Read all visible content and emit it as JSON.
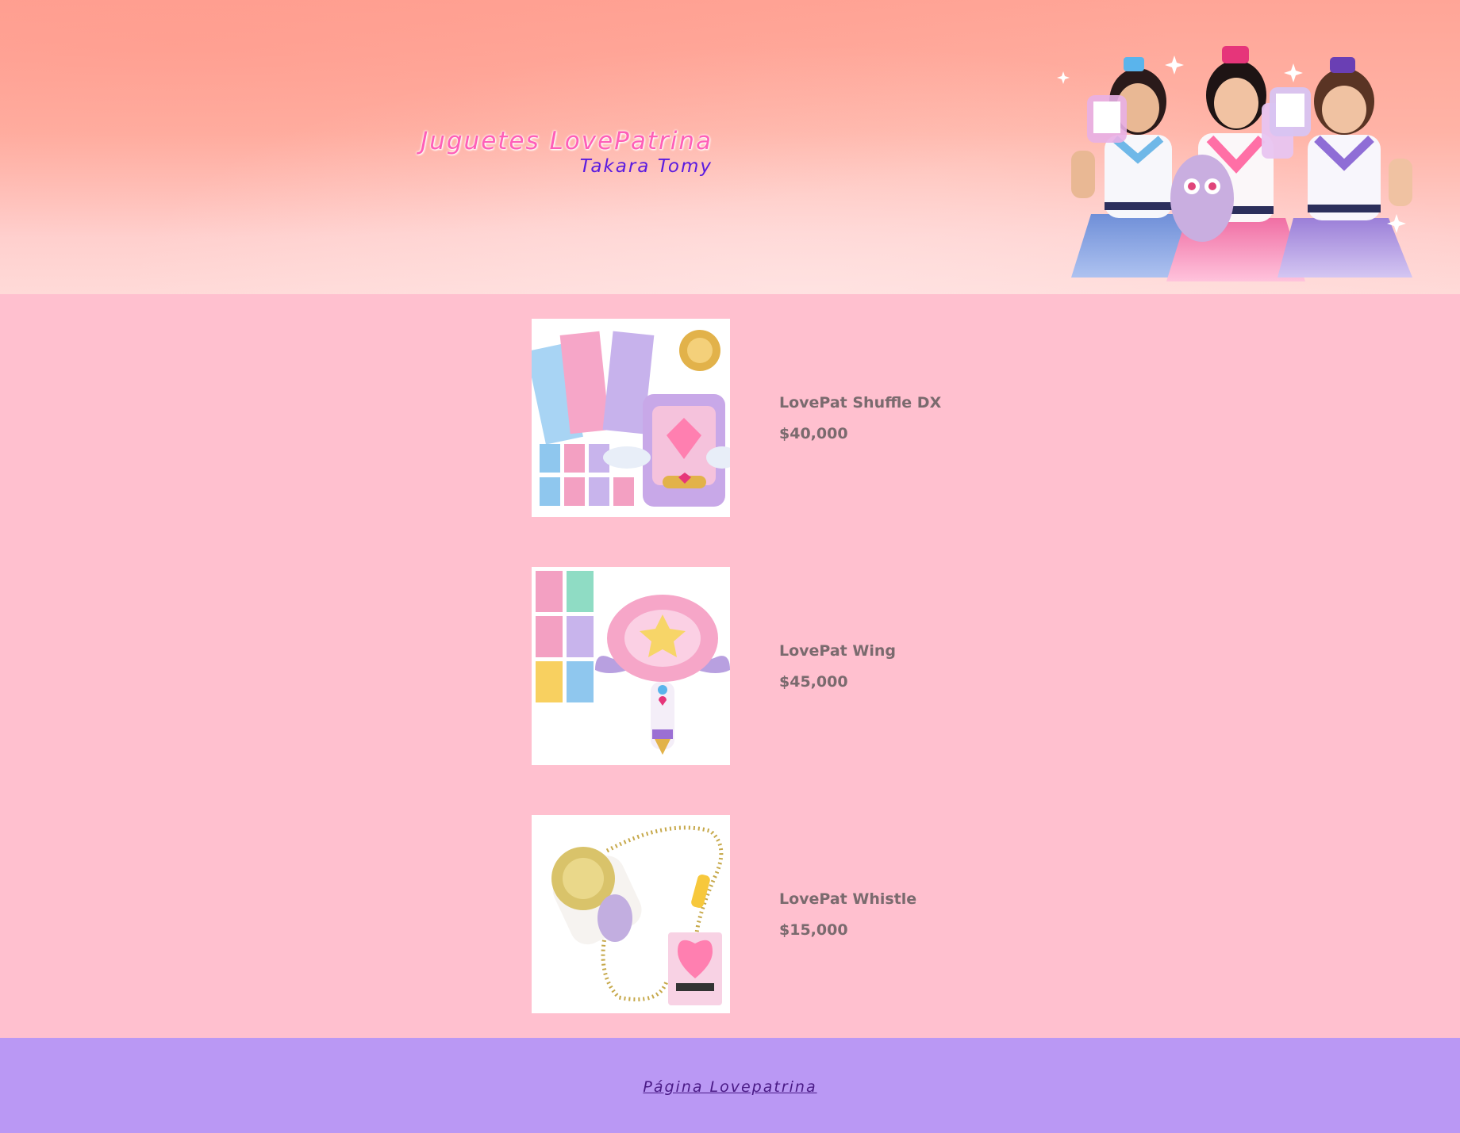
{
  "header": {
    "title": "Juguetes LovePatrina",
    "subtitle": "Takara Tomy",
    "banner_image": "lovepatrina-idols-group-photo"
  },
  "products": [
    {
      "name": "LovePat Shuffle DX",
      "price": "$40,000",
      "image": "shuffle-dx-toy-with-cards"
    },
    {
      "name": "LovePat Wing",
      "price": "$45,000",
      "image": "wing-wand-toy-with-cards"
    },
    {
      "name": "LovePat Whistle",
      "price": "$15,000",
      "image": "whistle-necklace-toy"
    }
  ],
  "footer": {
    "link_label": "Página Lovepatrina"
  },
  "colors": {
    "header_top": "#ffa597",
    "page_background": "#ffc0cf",
    "footer_background": "#ba98f4",
    "title_pink": "#ff5fb8",
    "subtitle_purple": "#5a1be0",
    "product_text": "#7a6a6e",
    "link_purple": "#4a1a86"
  }
}
